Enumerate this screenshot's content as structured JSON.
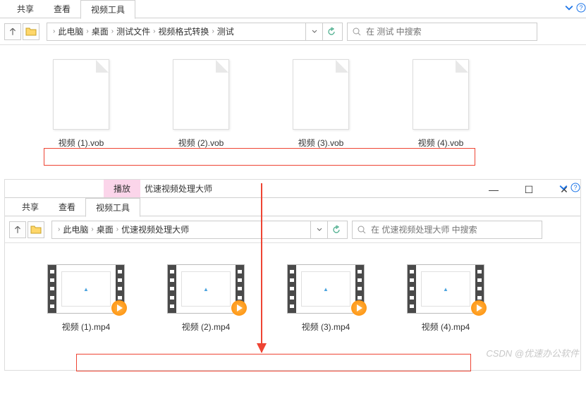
{
  "window1": {
    "tabs": {
      "share": "共享",
      "view": "查看",
      "videoTools": "视频工具"
    },
    "breadcrumbs": [
      "此电脑",
      "桌面",
      "测试文件",
      "视频格式转换",
      "测试"
    ],
    "search_placeholder": "在 测试 中搜索",
    "files": [
      {
        "name": "视频 (1).vob"
      },
      {
        "name": "视频 (2).vob"
      },
      {
        "name": "视频 (3).vob"
      },
      {
        "name": "视频 (4).vob"
      }
    ]
  },
  "window2": {
    "topTabs": {
      "play": "播放",
      "appname": "优速视频处理大师"
    },
    "tabs": {
      "share": "共享",
      "view": "查看",
      "videoTools": "视频工具"
    },
    "breadcrumbs": [
      "此电脑",
      "桌面",
      "优速视频处理大师"
    ],
    "search_placeholder": "在 优速视频处理大师 中搜索",
    "files": [
      {
        "name": "视频 (1).mp4"
      },
      {
        "name": "视频 (2).mp4"
      },
      {
        "name": "视频 (3).mp4"
      },
      {
        "name": "视频 (4).mp4"
      }
    ]
  },
  "watermark": "CSDN @优速办公软件"
}
